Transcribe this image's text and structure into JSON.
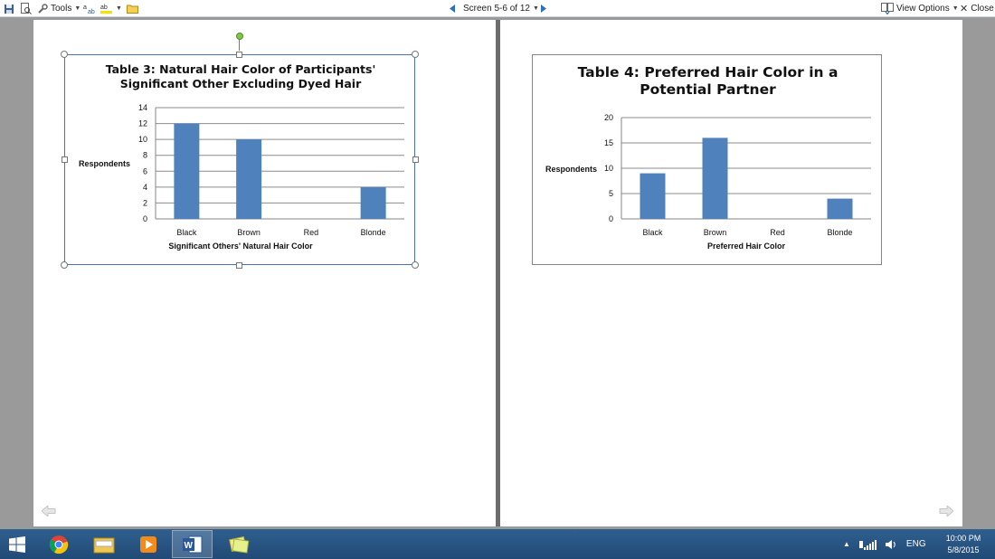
{
  "toolbar": {
    "tools_label": "Tools",
    "screen_label": "Screen 5-6 of 12",
    "view_options_label": "View Options",
    "close_label": "Close"
  },
  "charts": [
    {
      "title_line1": "Table 3: Natural Hair Color of Participants'",
      "title_line2": "Significant Other Excluding Dyed Hair",
      "ylabel": "Respondents",
      "xlabel": "Significant  Others' Natural Hair Color"
    },
    {
      "title_line1": "Table 4: Preferred Hair Color in a",
      "title_line2": "Potential Partner",
      "ylabel": "Respondents",
      "xlabel": "Preferred Hair Color"
    }
  ],
  "chart_data": [
    {
      "type": "bar",
      "title": "Table 3: Natural Hair Color of Participants' Significant Other Excluding Dyed Hair",
      "categories": [
        "Black",
        "Brown",
        "Red",
        "Blonde"
      ],
      "values": [
        12,
        10,
        0,
        4
      ],
      "ylim": [
        0,
        14
      ],
      "yticks": [
        0,
        2,
        4,
        6,
        8,
        10,
        12,
        14
      ],
      "ylabel": "Respondents",
      "xlabel": "Significant  Others' Natural Hair Color",
      "grid": true,
      "bar_color": "#4f81bd"
    },
    {
      "type": "bar",
      "title": "Table 4: Preferred Hair Color in a Potential Partner",
      "categories": [
        "Black",
        "Brown",
        "Red",
        "Blonde"
      ],
      "values": [
        9,
        16,
        0,
        4
      ],
      "ylim": [
        0,
        20
      ],
      "yticks": [
        0,
        5,
        10,
        15,
        20
      ],
      "ylabel": "Respondents",
      "xlabel": "Preferred Hair Color",
      "grid": true,
      "bar_color": "#4f81bd"
    }
  ],
  "taskbar": {
    "language": "ENG",
    "time": "10:00 PM",
    "date": "5/8/2015"
  },
  "colors": {
    "accent": "#4f81bd",
    "taskbar": "#2a5584",
    "selection": "#4a73a8"
  }
}
